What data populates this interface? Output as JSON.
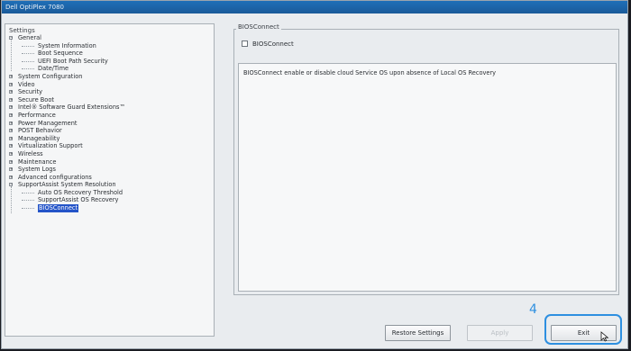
{
  "window": {
    "title": "Dell OptiPlex 7080"
  },
  "tree": {
    "header": "Settings",
    "items": [
      {
        "label": "General",
        "level": 0,
        "expander": "−"
      },
      {
        "label": "System Information",
        "level": 1
      },
      {
        "label": "Boot Sequence",
        "level": 1
      },
      {
        "label": "UEFI Boot Path Security",
        "level": 1
      },
      {
        "label": "Date/Time",
        "level": 1
      },
      {
        "label": "System Configuration",
        "level": 0,
        "expander": "+"
      },
      {
        "label": "Video",
        "level": 0,
        "expander": "+"
      },
      {
        "label": "Security",
        "level": 0,
        "expander": "+"
      },
      {
        "label": "Secure Boot",
        "level": 0,
        "expander": "+"
      },
      {
        "label": "Intel® Software Guard Extensions™",
        "level": 0,
        "expander": "+"
      },
      {
        "label": "Performance",
        "level": 0,
        "expander": "+"
      },
      {
        "label": "Power Management",
        "level": 0,
        "expander": "+"
      },
      {
        "label": "POST Behavior",
        "level": 0,
        "expander": "+"
      },
      {
        "label": "Manageability",
        "level": 0,
        "expander": "+"
      },
      {
        "label": "Virtualization Support",
        "level": 0,
        "expander": "+"
      },
      {
        "label": "Wireless",
        "level": 0,
        "expander": "+"
      },
      {
        "label": "Maintenance",
        "level": 0,
        "expander": "+"
      },
      {
        "label": "System Logs",
        "level": 0,
        "expander": "+"
      },
      {
        "label": "Advanced configurations",
        "level": 0,
        "expander": "+"
      },
      {
        "label": "SupportAssist System Resolution",
        "level": 0,
        "expander": "−"
      },
      {
        "label": "Auto OS Recovery Threshold",
        "level": 1
      },
      {
        "label": "SupportAssist OS Recovery",
        "level": 1
      },
      {
        "label": "BIOSConnect",
        "level": 1,
        "selected": true
      }
    ]
  },
  "panel": {
    "group_title": "BIOSConnect",
    "checkbox_label": "BIOSConnect",
    "checkbox_checked": false,
    "description": "BIOSConnect enable or disable cloud Service OS upon absence of Local OS Recovery"
  },
  "buttons": {
    "restore": "Restore Settings",
    "apply": "Apply",
    "exit": "Exit"
  },
  "annotation": {
    "number": "4",
    "color": "#2d8fe0"
  },
  "colors": {
    "selection": "#2454c8",
    "titlebar": "#1f6fb8"
  }
}
